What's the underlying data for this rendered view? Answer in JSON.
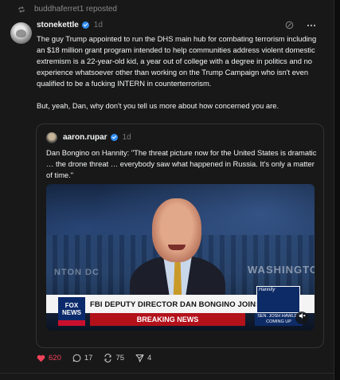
{
  "repost": {
    "text": "buddhaferret1 reposted",
    "icon": "repost-icon"
  },
  "post": {
    "username": "stoneketle",
    "username_display": "stonekettle",
    "time": "1d",
    "body": "The guy Trump appointed to run the DHS main hub for combating terrorism including an $18 million grant program intended to help communities address violent domestic extremism is a 22-year-old kid, a year out of college with a degree in politics and no experience whatsoever other than working on the Trump Campaign who isn't even qualified to be a fucking INTERN in counterterrorism.\n\nBut, yeah, Dan, why don't you tell us more about how concerned you are."
  },
  "quote": {
    "username": "aaron.rupar",
    "time": "1d",
    "body": "Dan Bongino on Hannity: \"The threat picture now for the United States is dramatic … the drone threat … everybody saw what happened in Russia. It's only a matter of time.\"",
    "video": {
      "backdrop_left": "NTON DC",
      "backdrop_right": "WASHINGTO",
      "logo_line1": "FOX",
      "logo_line2": "NEWS",
      "logo_line3": "channel",
      "headline": "FBI DEPUTY DIRECTOR DAN BONGINO JOINS HANNITY",
      "breaking": "BREAKING NEWS",
      "show_name": "Hannity",
      "coming_up": "SEN. JOSH HAWLEY COMING UP",
      "mute_icon": "speaker-muted-icon"
    }
  },
  "actions": {
    "likes": "620",
    "comments": "17",
    "reposts": "75",
    "shares": "4"
  },
  "colors": {
    "like": "#f0435a",
    "verified": "#2f8cf0",
    "background": "#181818"
  }
}
